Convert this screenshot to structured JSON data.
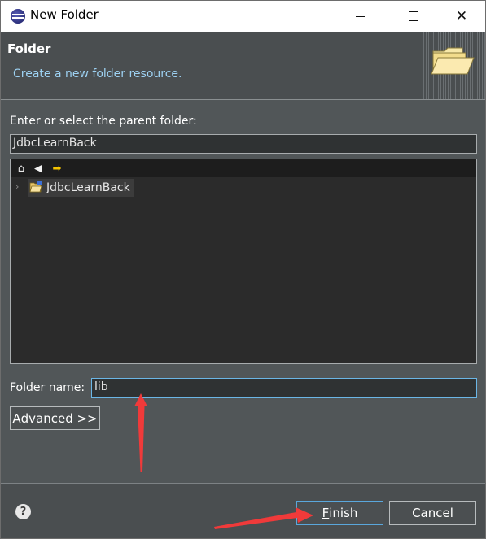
{
  "window": {
    "title": "New Folder",
    "icons": {
      "app": "eclipse-icon",
      "minimize": "minimize-icon",
      "maximize": "maximize-icon",
      "close": "close-icon"
    }
  },
  "banner": {
    "title": "Folder",
    "description": "Create a new folder resource.",
    "icon": "folder-icon"
  },
  "parent": {
    "label": "Enter or select the parent folder:",
    "value": "JdbcLearnBack"
  },
  "tree": {
    "toolbar_icons": [
      "home-icon",
      "back-arrow-icon",
      "forward-arrow-icon"
    ],
    "items": [
      {
        "label": "JdbcLearnBack",
        "icon": "project-folder-icon",
        "expanded": false
      }
    ]
  },
  "folder_name": {
    "label": "Folder name:",
    "value": "lib"
  },
  "buttons": {
    "advanced_mnemonic": "A",
    "advanced_rest": "dvanced >>",
    "finish_mnemonic": "F",
    "finish_rest": "inish",
    "cancel": "Cancel"
  },
  "help_icon": "?",
  "colors": {
    "background": "#515658",
    "banner": "#4a4e50",
    "description_text": "#9dd1f2",
    "focus_border": "#6bb6e6",
    "annotation_arrow": "#f03a3a"
  }
}
